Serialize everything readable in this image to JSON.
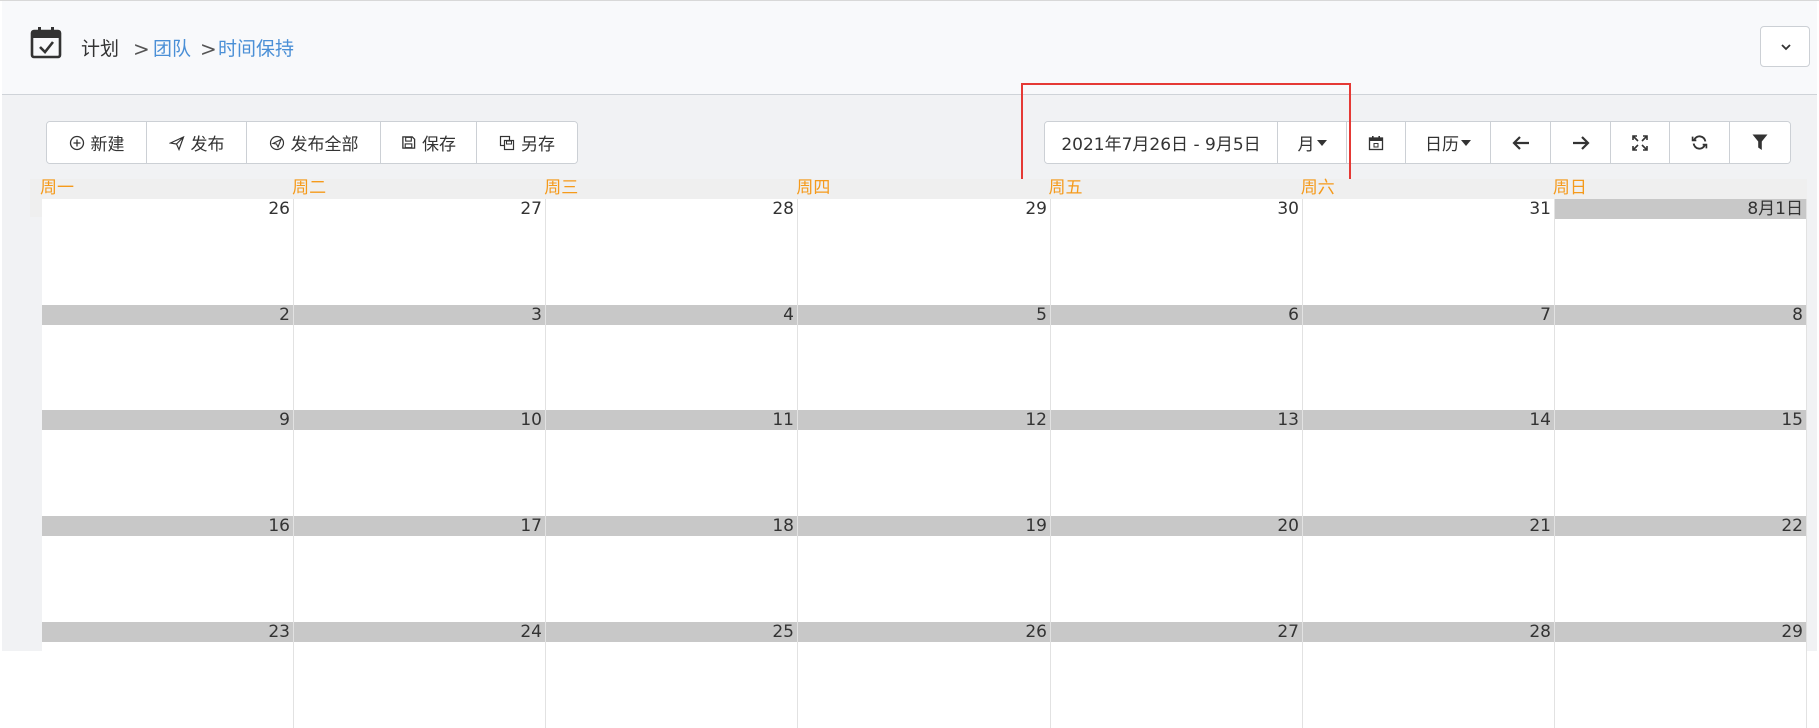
{
  "breadcrumb": {
    "root": "计划",
    "sep": ">",
    "team": "团队",
    "current": "时间保持"
  },
  "toolbar_left": [
    {
      "icon": "plus-circle-icon",
      "label": "新建"
    },
    {
      "icon": "send-icon",
      "label": "发布"
    },
    {
      "icon": "send-all-icon",
      "label": "发布全部"
    },
    {
      "icon": "save-icon",
      "label": "保存"
    },
    {
      "icon": "save-as-icon",
      "label": "另存"
    }
  ],
  "toolbar_right": {
    "date_range": "2021年7月26日 - 9月5日",
    "view_mode": "月",
    "calendar_type": "日历",
    "icons": [
      "calendar-icon",
      "arrow-left-icon",
      "arrow-right-icon",
      "fullscreen-icon",
      "refresh-icon",
      "filter-icon"
    ]
  },
  "weekdays": [
    "周一",
    "周二",
    "周三",
    "周四",
    "周五",
    "周六",
    "周日"
  ],
  "weeks": [
    [
      "26",
      "27",
      "28",
      "29",
      "30",
      "31",
      "8月1日"
    ],
    [
      "2",
      "3",
      "4",
      "5",
      "6",
      "7",
      "8"
    ],
    [
      "9",
      "10",
      "11",
      "12",
      "13",
      "14",
      "15"
    ],
    [
      "16",
      "17",
      "18",
      "19",
      "20",
      "21",
      "22"
    ],
    [
      "23",
      "24",
      "25",
      "26",
      "27",
      "28",
      "29"
    ]
  ],
  "colors": {
    "accent": "#4a8fd6",
    "weekday": "#f59a1b",
    "highlight": "#e53935"
  }
}
